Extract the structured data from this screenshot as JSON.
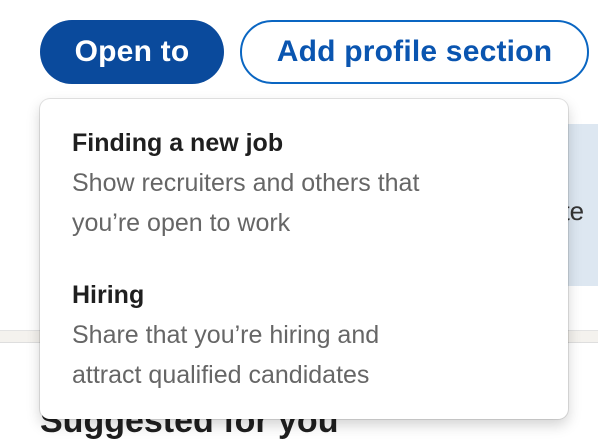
{
  "actions": {
    "open_to_label": "Open to",
    "add_profile_section_label": "Add profile section"
  },
  "open_to_menu": {
    "items": [
      {
        "title": "Finding a new job",
        "description_line1": "Show recruiters and others that",
        "description_line2": "you’re open to work"
      },
      {
        "title": "Hiring",
        "description_line1": "Share that you’re hiring and",
        "description_line2": "attract qualified candidates"
      }
    ]
  },
  "background": {
    "partial_banner_text": "nte",
    "section_heading": "Suggested for you"
  },
  "colors": {
    "primary_button": "#0a4a9c",
    "secondary_border": "#0a66c2",
    "banner_bg": "#dde7f1"
  }
}
